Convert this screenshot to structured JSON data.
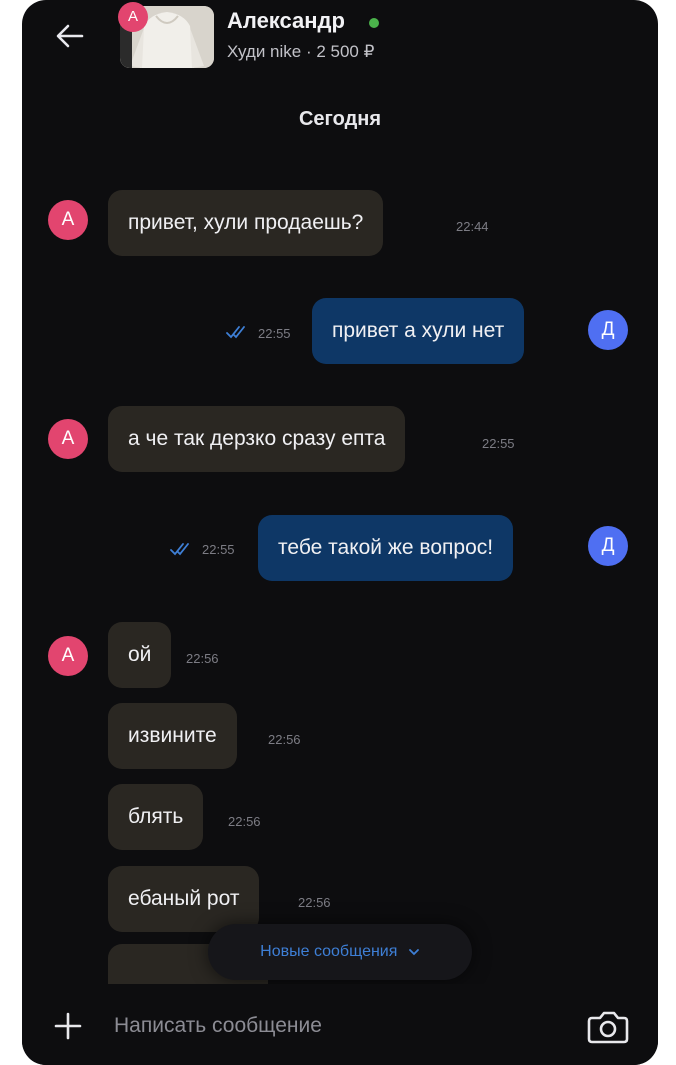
{
  "header": {
    "contact_name": "Александр",
    "listing": "Худи nike · 2 500 ₽",
    "avatar_letter": "А",
    "online_color": "#4bb34b"
  },
  "date_separator": "Сегодня",
  "messages": [
    {
      "side": "in",
      "avatar": "А",
      "text": "привет, хули продаешь?",
      "time": "22:44"
    },
    {
      "side": "out",
      "avatar": "Д",
      "text": "привет а хули нет",
      "time": "22:55",
      "status": "read"
    },
    {
      "side": "in",
      "avatar": "А",
      "text": "а че так дерзко сразу епта",
      "time": "22:55"
    },
    {
      "side": "out",
      "avatar": "Д",
      "text": "тебе такой же вопрос!",
      "time": "22:55",
      "status": "read"
    },
    {
      "side": "in",
      "avatar": "А",
      "text": "ой",
      "time": "22:56"
    },
    {
      "side": "in",
      "text": "извините",
      "time": "22:56"
    },
    {
      "side": "in",
      "text": "блять",
      "time": "22:56"
    },
    {
      "side": "in",
      "text": "ебаный рот",
      "time": "22:56"
    }
  ],
  "new_messages_label": "Новые сообщения",
  "composer": {
    "placeholder": "Написать сообщение"
  },
  "icons": {
    "back": "arrow-left-icon",
    "plus": "plus-icon",
    "camera": "camera-icon",
    "ticks": "double-check-icon",
    "chevron": "chevron-down-icon"
  },
  "colors": {
    "incoming_bubble": "#2a2722",
    "outgoing_bubble": "#0e3766",
    "avatar_a": "#e2456f",
    "avatar_d": "#4f6ff2",
    "accent": "#3e7fd6"
  }
}
